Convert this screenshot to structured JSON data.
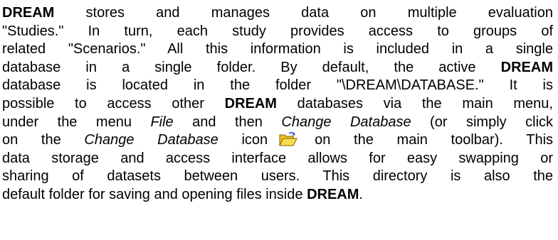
{
  "paragraph": {
    "l1_bold": "DREAM",
    "l1_text": " stores and manages data on multiple evaluation",
    "l2_text": "\"Studies.\" In turn, each study provides access to groups of",
    "l3_text": "related \"Scenarios.\" All this information is included in a single",
    "l4_text": "database in a single folder. By default, the active ",
    "l4_bold": "DREAM",
    "l5_text": "database is located in the folder \"\\DREAM\\DATABASE.\" It is",
    "l6_text": "possible to access other ",
    "l6_bold": "DREAM",
    "l6_text2": " databases via the main menu,",
    "l7_text": "under the menu ",
    "l7_italic": "File",
    "l7_text2": " and then ",
    "l7_italic2": "Change Database",
    "l7_text3": " (or simply click",
    "l8_text": "on the ",
    "l8_italic": "Change Database",
    "l8_text2": " icon",
    "l8_text3": "on the main toolbar). This",
    "l9_text": "data storage and access interface allows for easy swapping or",
    "l10_text": "sharing of datasets between users. This directory is also the",
    "l11_text": "default folder for saving and opening files inside ",
    "l11_bold": "DREAM",
    "l11_end": "."
  },
  "icons": {
    "change_database": "open-folder-icon"
  },
  "colors": {
    "text": "#000000",
    "folder_body": "#f0c020",
    "folder_front": "#f8dc50",
    "folder_outline": "#806000",
    "arrow": "#3050c0"
  }
}
